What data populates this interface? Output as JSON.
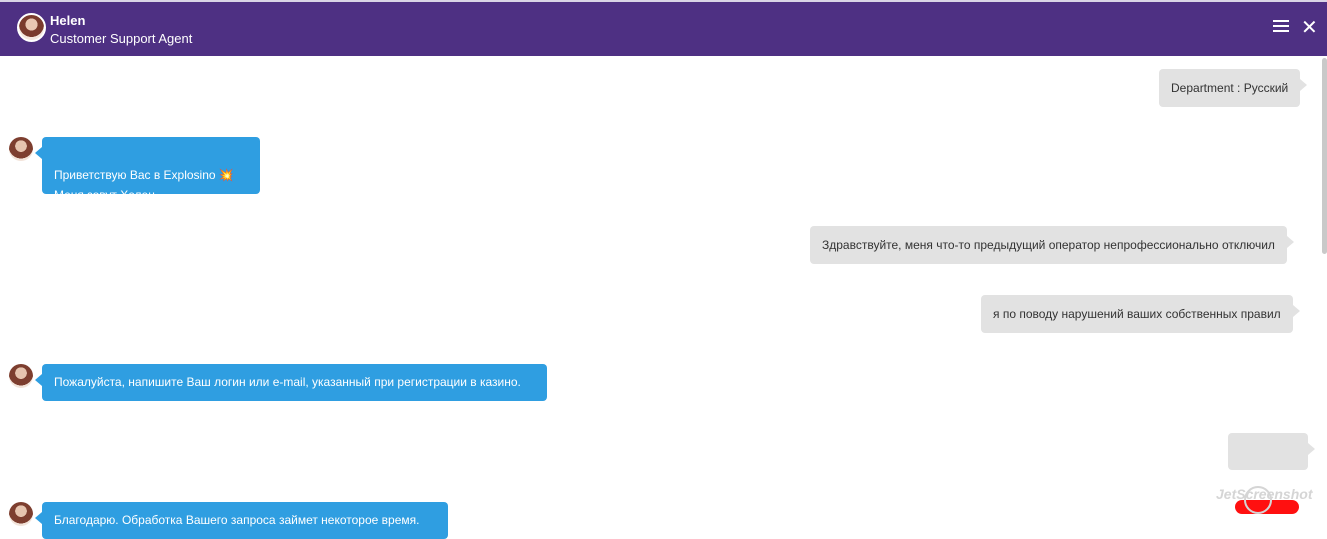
{
  "header": {
    "name": "Helen",
    "role": "Customer Support Agent"
  },
  "messages": [
    {
      "side": "user",
      "text": "Department : Русский"
    },
    {
      "side": "agent",
      "text": "Приветствую Вас в Explosino 💥\nМеня зовут Хелен."
    },
    {
      "side": "user",
      "text": "Здравствуйте, меня что-то предыдущий оператор непрофессионально отключил"
    },
    {
      "side": "user",
      "text": "я по поводу нарушений ваших собственных правил"
    },
    {
      "side": "agent",
      "text": "Пожалуйста, напишите Ваш логин или e-mail, указанный при регистрации в казино."
    },
    {
      "side": "agent",
      "text": "Благодарю. Обработка Вашего запроса займет некоторое время."
    }
  ],
  "icons": {
    "menu": "menu-icon",
    "close": "close-icon"
  },
  "colors": {
    "header": "#4e3083",
    "agent_bubble": "#2f9ee1",
    "user_bubble": "#e2e2e2",
    "redaction": "#ff1010"
  },
  "watermark": "JetScreenshot"
}
